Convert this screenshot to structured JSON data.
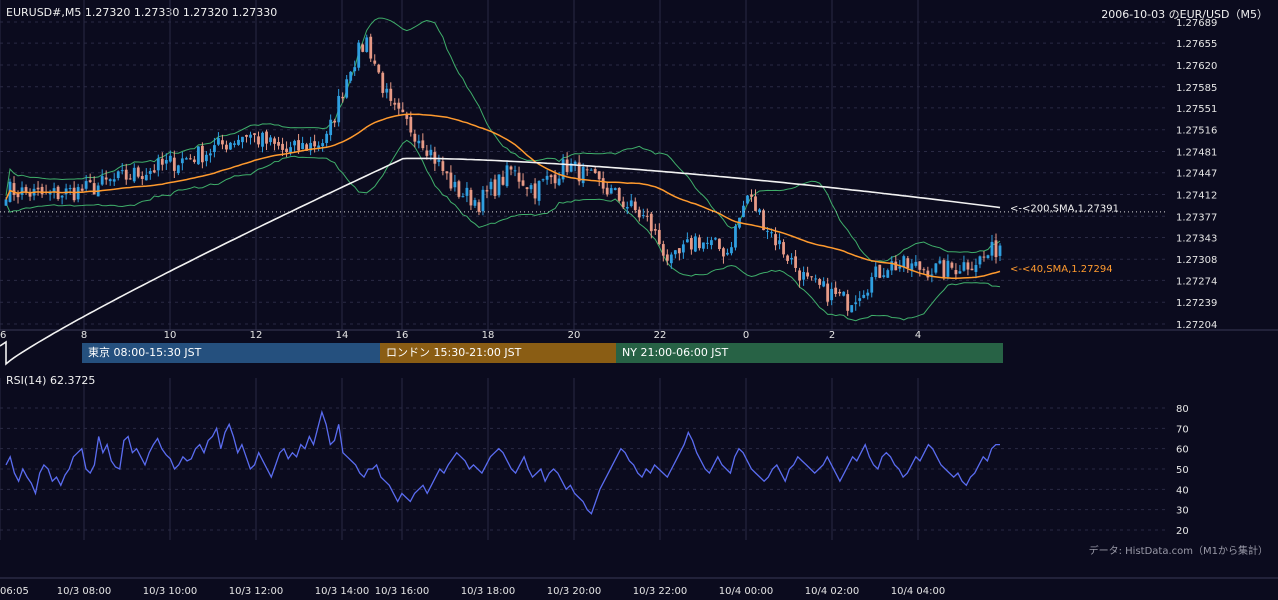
{
  "header": {
    "quote": "EURUSD#,M5 1.27320 1.27330 1.27320 1.27330",
    "title": "2006-10-03 のEUR/USD（M5）"
  },
  "sessions": [
    {
      "label": "東京 08:00-15:30 JST",
      "color": "#25507e"
    },
    {
      "label": "ロンドン 15:30-21:00 JST",
      "color": "#8a5d14"
    },
    {
      "label": "NY 21:00-06:00 JST",
      "color": "#276245"
    }
  ],
  "rsi_label": "RSI(14) 62.3725",
  "source": "データ: HistData.com（M1から集計）",
  "colors": {
    "background": "#0b0b1e",
    "bull": "#2f9fe0",
    "bear": "#e79a86",
    "sma40": "#ff9a2e",
    "sma200": "#f2f2f2",
    "bollinger": "#3fae6a",
    "rsi": "#5a6cf0",
    "grid": "#2a2a44"
  },
  "chart_data": [
    {
      "type": "candlestick",
      "title": "",
      "ylim": [
        1.27204,
        1.27689
      ],
      "y_ticks": [
        "1.27689",
        "1.27655",
        "1.27620",
        "1.27585",
        "1.27551",
        "1.27516",
        "1.27481",
        "1.27447",
        "1.27412",
        "1.27377",
        "1.27343",
        "1.27308",
        "1.27274",
        "1.27239",
        "1.27204"
      ],
      "x_ticks_hour": [
        "6",
        "8",
        "10",
        "12",
        "14",
        "16",
        "18",
        "20",
        "22",
        "0",
        "2",
        "4"
      ],
      "x_ticks_time": [
        "06:05",
        "10/3 08:00",
        "10/3 10:00",
        "10/3 12:00",
        "10/3 14:00",
        "10/3 16:00",
        "10/3 18:00",
        "10/3 20:00",
        "10/3 22:00",
        "10/4 00:00",
        "10/4 02:00",
        "10/4 04:00"
      ],
      "last_close": 1.2733,
      "series": [
        {
          "name": "<-<200,SMA,1.27391",
          "kind": "sma",
          "last": 1.27391
        },
        {
          "name": "<-<40,SMA,1.27294",
          "kind": "sma",
          "last": 1.27294
        }
      ],
      "close_anchors": [
        [
          0,
          1.2742
        ],
        [
          10,
          1.2741
        ],
        [
          20,
          1.2742
        ],
        [
          30,
          1.2744
        ],
        [
          40,
          1.2746
        ],
        [
          50,
          1.2748
        ],
        [
          60,
          1.2751
        ],
        [
          70,
          1.2748
        ],
        [
          80,
          1.275
        ],
        [
          86,
          1.2762
        ],
        [
          90,
          1.2766
        ],
        [
          96,
          1.2755
        ],
        [
          104,
          1.275
        ],
        [
          112,
          1.2742
        ],
        [
          118,
          1.274
        ],
        [
          126,
          1.2745
        ],
        [
          132,
          1.2742
        ],
        [
          140,
          1.2746
        ],
        [
          150,
          1.2742
        ],
        [
          160,
          1.2737
        ],
        [
          166,
          1.273
        ],
        [
          172,
          1.2734
        ],
        [
          180,
          1.2732
        ],
        [
          185,
          1.2741
        ],
        [
          192,
          1.2734
        ],
        [
          200,
          1.2727
        ],
        [
          210,
          1.2724
        ],
        [
          220,
          1.273
        ],
        [
          234,
          1.2729
        ],
        [
          244,
          1.2731
        ],
        [
          248,
          1.2733
        ]
      ],
      "note_bars": 249
    },
    {
      "type": "line",
      "title": "",
      "ylim": [
        20,
        80
      ],
      "y_ticks": [
        20,
        30,
        40,
        50,
        60,
        70,
        80
      ],
      "series": [
        {
          "name": "",
          "last": 62.3725
        }
      ],
      "values": [
        52,
        56,
        48,
        44,
        50,
        46,
        43,
        38,
        48,
        52,
        50,
        44,
        46,
        42,
        47,
        50,
        56,
        58,
        60,
        50,
        48,
        52,
        66,
        58,
        62,
        54,
        51,
        50,
        64,
        66,
        58,
        60,
        56,
        52,
        58,
        62,
        65,
        60,
        57,
        55,
        50,
        52,
        56,
        54,
        55,
        60,
        62,
        58,
        64,
        66,
        70,
        60,
        68,
        72,
        66,
        58,
        62,
        56,
        50,
        52,
        58,
        54,
        50,
        46,
        52,
        58,
        60,
        55,
        58,
        56,
        62,
        60,
        66,
        62,
        70,
        78,
        72,
        62,
        64,
        72,
        58,
        56,
        54,
        52,
        48,
        46,
        50,
        50,
        52,
        46,
        44,
        42,
        38,
        34,
        38,
        36,
        34,
        38,
        40,
        42,
        38,
        42,
        46,
        50,
        48,
        52,
        55,
        58,
        56,
        54,
        50,
        52,
        50,
        48,
        52,
        56,
        58,
        60,
        58,
        54,
        50,
        48,
        52,
        56,
        50,
        46,
        48,
        50,
        44,
        48,
        50,
        48,
        44,
        40,
        42,
        38,
        36,
        34,
        30,
        28,
        34,
        40,
        44,
        48,
        52,
        56,
        60,
        58,
        54,
        52,
        48,
        46,
        50,
        48,
        52,
        50,
        48,
        46,
        50,
        54,
        58,
        62,
        68,
        64,
        58,
        54,
        50,
        48,
        52,
        56,
        52,
        50,
        48,
        56,
        60,
        58,
        54,
        50,
        48,
        46,
        44,
        46,
        50,
        52,
        48,
        44,
        50,
        52,
        56,
        54,
        52,
        50,
        48,
        50,
        52,
        56,
        52,
        48,
        44,
        48,
        52,
        56,
        54,
        58,
        62,
        56,
        52,
        50,
        56,
        58,
        56,
        52,
        50,
        46,
        48,
        52,
        56,
        54,
        58,
        62,
        60,
        56,
        52,
        50,
        48,
        46,
        48,
        44,
        42,
        46,
        48,
        52,
        56,
        54,
        60,
        62,
        62
      ]
    }
  ]
}
